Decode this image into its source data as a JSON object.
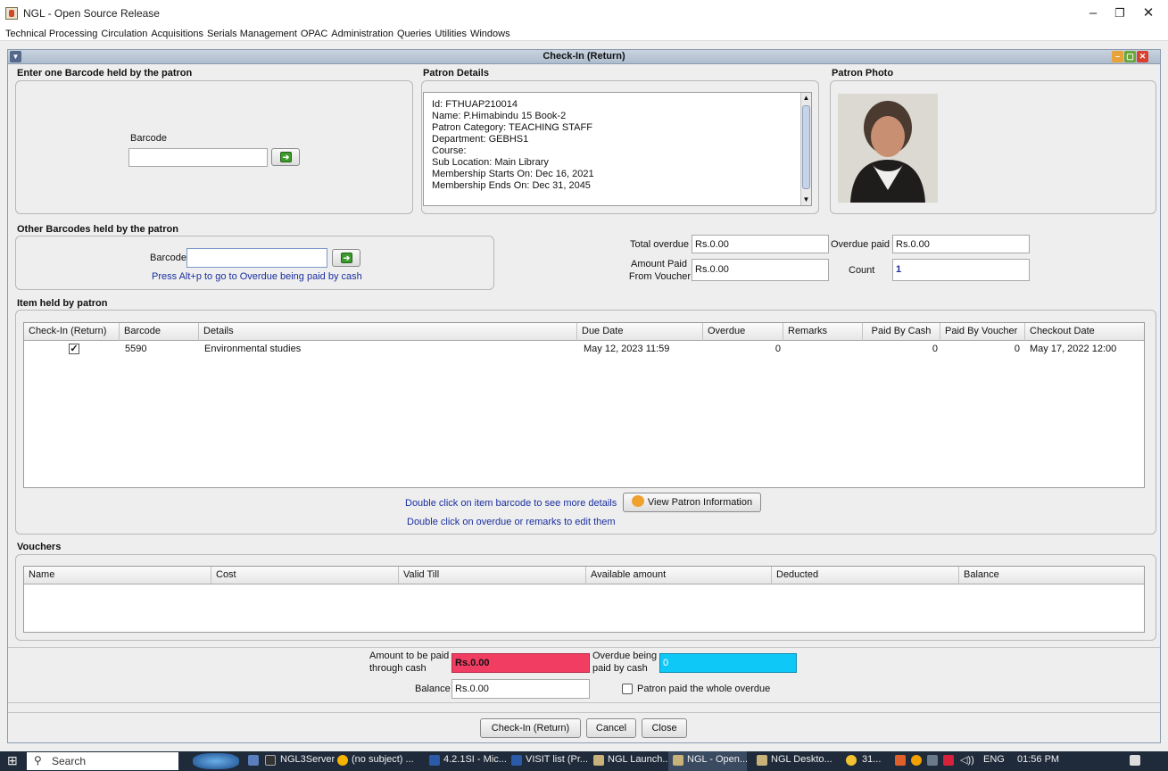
{
  "window": {
    "title": "NGL - Open Source Release",
    "minimize": "–",
    "restore": "❐",
    "close": "✕"
  },
  "menu": [
    "Technical Processing",
    "Circulation",
    "Acquisitions",
    "Serials Management",
    "OPAC",
    "Administration",
    "Queries",
    "Utilities",
    "Windows"
  ],
  "frame": {
    "title": "Check-In (Return)"
  },
  "barcode_section": {
    "label": "Enter one Barcode held by the patron",
    "field_label": "Barcode",
    "value": ""
  },
  "patron_details": {
    "label": "Patron Details",
    "lines": [
      "Id: FTHUAP210014",
      "Name: P.Himabindu 15 Book-2",
      "Patron Category: TEACHING STAFF",
      "Department: GEBHS1",
      "Course:",
      "Sub Location: Main Library",
      "Membership Starts On: Dec 16, 2021",
      "Membership Ends On: Dec 31, 2045"
    ]
  },
  "patron_photo": {
    "label": "Patron Photo"
  },
  "other_barcodes": {
    "label": "Other Barcodes held by the patron",
    "field_label": "Barcode",
    "value": "",
    "hint": "Press Alt+p to go to Overdue being paid by cash"
  },
  "summary": {
    "total_overdue_label": "Total overdue",
    "total_overdue": "Rs.0.00",
    "overdue_paid_label": "Overdue paid",
    "overdue_paid": "Rs.0.00",
    "amount_paid_voucher_label_1": "Amount Paid",
    "amount_paid_voucher_label_2": "From Voucher",
    "amount_paid_voucher": "Rs.0.00",
    "count_label": "Count",
    "count": "1"
  },
  "items": {
    "label": "Item held by patron",
    "columns": [
      "Check-In (Return)",
      "Barcode",
      "Details",
      "Due Date",
      "Overdue",
      "Remarks",
      "Paid By Cash",
      "Paid By Voucher",
      "Checkout Date"
    ],
    "rows": [
      {
        "checked": true,
        "barcode": "5590",
        "details": "Environmental studies",
        "due_date": "May 12, 2023 11:59",
        "overdue": "0",
        "remarks": "",
        "paid_cash": "0",
        "paid_voucher": "0",
        "checkout_date": "May 17, 2022 12:00"
      }
    ],
    "hint1": "Double click on item barcode to see more details",
    "hint2": "Double click on overdue or remarks to edit them",
    "view_patron_btn": "View Patron Information"
  },
  "vouchers": {
    "label": "Vouchers",
    "columns": [
      "Name",
      "Cost",
      "Valid Till",
      "Available amount",
      "Deducted",
      "Balance"
    ]
  },
  "payment": {
    "amount_cash_label_1": "Amount to be paid",
    "amount_cash_label_2": "through cash",
    "amount_cash": "Rs.0.00",
    "overdue_cash_label_1": "Overdue being",
    "overdue_cash_label_2": "paid by cash",
    "overdue_cash": "0",
    "balance_label": "Balance",
    "balance": "Rs.0.00",
    "paid_whole_label": "Patron paid the whole overdue",
    "colors": {
      "amount_cash_bg": "#f23d62",
      "overdue_cash_bg": "#0ec8f7"
    }
  },
  "buttons": {
    "checkin": "Check-In (Return)",
    "cancel": "Cancel",
    "close": "Close"
  },
  "taskbar": {
    "search": "Search",
    "items": [
      "NGL3Server",
      "(no subject) ...",
      "4.2.1SI - Mic...",
      "VISIT list (Pr...",
      "NGL Launch...",
      "NGL - Open...",
      "NGL Deskto..."
    ],
    "tray_count": "31...",
    "lang": "ENG",
    "time": "01:56 PM"
  }
}
